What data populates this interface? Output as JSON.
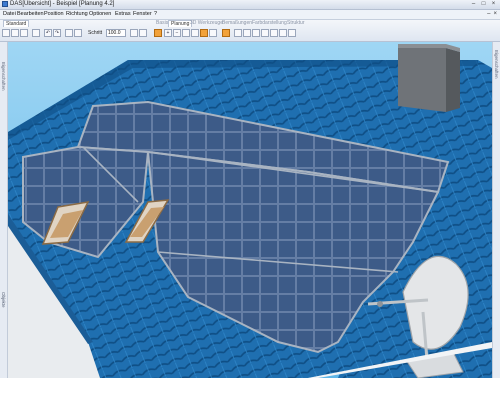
{
  "window": {
    "title": "DAS[Übersicht] - Beispiel [Planung 4.2]"
  },
  "menu": [
    "Datei",
    "Bearbeiten",
    "Position",
    "Richtung",
    "Optionen",
    "Extras",
    "Fenster",
    "?"
  ],
  "toolbar": {
    "tab_standard": "Standard",
    "tabs": [
      "Basis",
      "Planung",
      "3D Werkzeuge",
      "Bemaßungen",
      "Farbdarstellung",
      "Struktur"
    ],
    "scale_label": "Schritt",
    "scale_value": "100.0"
  },
  "side_panels": {
    "left_label": "Objekte",
    "left_label2": "Eigenschaften",
    "right_label": "Eigenschaften"
  },
  "scene": {
    "icons": [
      "new-icon",
      "open-icon",
      "save-icon",
      "print-icon",
      "undo-icon",
      "redo-icon",
      "cut-icon",
      "copy-icon",
      "paste-icon",
      "zoom-in-icon",
      "zoom-out-icon",
      "rotate-icon",
      "pan-icon",
      "select-icon",
      "measure-icon",
      "grid-icon",
      "light-icon",
      "camera-icon"
    ],
    "colors": {
      "sky": "#7ec8f0",
      "roof": "#1f72b3",
      "panel": "#3b5a86",
      "wall": "#e9ecef",
      "chimney": "#6f7378"
    }
  }
}
